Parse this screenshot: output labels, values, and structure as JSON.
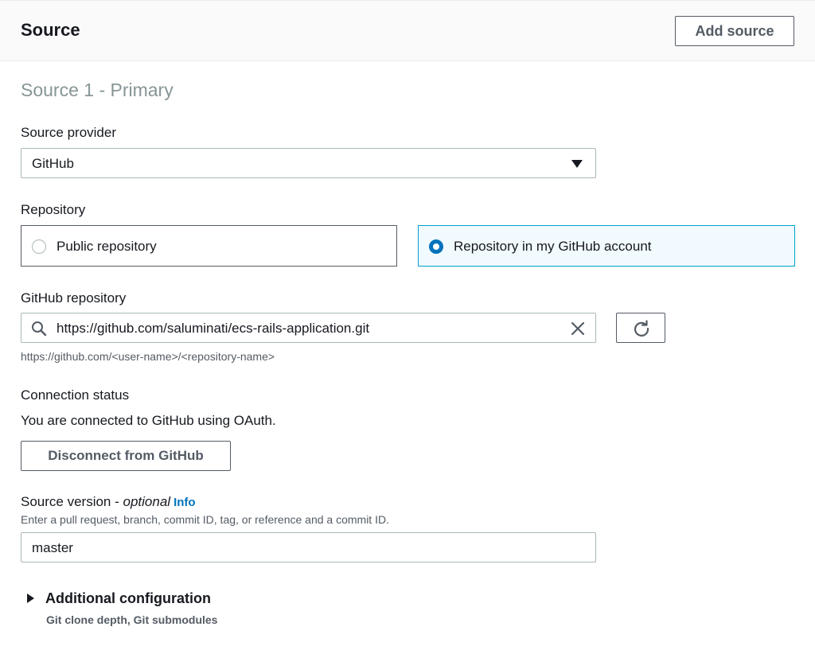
{
  "header": {
    "title": "Source",
    "add_source_label": "Add source"
  },
  "section": {
    "title": "Source 1 - Primary"
  },
  "source_provider": {
    "label": "Source provider",
    "selected": "GitHub"
  },
  "repository": {
    "label": "Repository",
    "options": [
      {
        "label": "Public repository",
        "selected": false
      },
      {
        "label": "Repository in my GitHub account",
        "selected": true
      }
    ]
  },
  "github_repository": {
    "label": "GitHub repository",
    "value": "https://github.com/saluminati/ecs-rails-application.git",
    "hint": "https://github.com/<user-name>/<repository-name>"
  },
  "connection": {
    "label": "Connection status",
    "status_text": "You are connected to GitHub using OAuth.",
    "disconnect_label": "Disconnect from GitHub"
  },
  "source_version": {
    "label": "Source version - ",
    "optional": "optional",
    "info": "Info",
    "description": "Enter a pull request, branch, commit ID, tag, or reference and a commit ID.",
    "value": "master"
  },
  "additional": {
    "title": "Additional configuration",
    "subtitle": "Git clone depth, Git submodules"
  },
  "colors": {
    "accent": "#0073bb",
    "selected_border": "#00a1c9",
    "selected_bg": "#f1faff"
  }
}
